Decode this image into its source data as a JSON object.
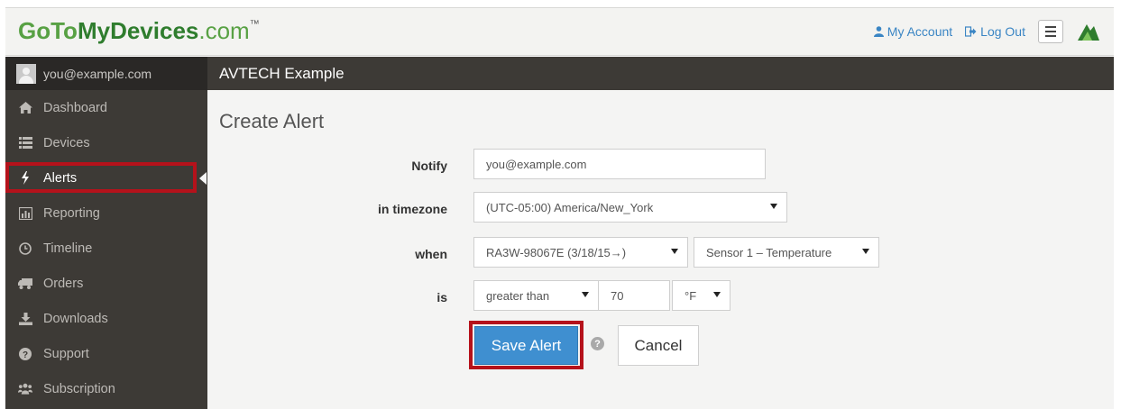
{
  "brand": {
    "part1": "GoTo",
    "part2": "MyDevices",
    "part3": ".com",
    "tm": "™"
  },
  "topnav": {
    "account": "My Account",
    "logout": "Log Out"
  },
  "sidebar": {
    "user_email": "you@example.com",
    "items": [
      {
        "label": "Dashboard",
        "icon": "home-icon"
      },
      {
        "label": "Devices",
        "icon": "list-icon"
      },
      {
        "label": "Alerts",
        "icon": "bolt-icon",
        "active": true
      },
      {
        "label": "Reporting",
        "icon": "bar-chart-icon"
      },
      {
        "label": "Timeline",
        "icon": "clock-icon"
      },
      {
        "label": "Orders",
        "icon": "truck-icon"
      },
      {
        "label": "Downloads",
        "icon": "download-icon"
      },
      {
        "label": "Support",
        "icon": "question-icon"
      },
      {
        "label": "Subscription",
        "icon": "users-icon"
      }
    ]
  },
  "main": {
    "header": "AVTECH Example",
    "title": "Create Alert",
    "form": {
      "notify_label": "Notify",
      "notify_value": "you@example.com",
      "timezone_label": "in timezone",
      "timezone_value": "(UTC-05:00) America/New_York",
      "when_label": "when",
      "device_value": "RA3W-98067E (3/18/15→)",
      "sensor_value": "Sensor 1 – Temperature",
      "is_label": "is",
      "comparator_value": "greater than",
      "threshold_value": "70",
      "unit_value": "°F"
    },
    "buttons": {
      "save": "Save Alert",
      "help": "?",
      "cancel": "Cancel"
    }
  },
  "colors": {
    "brand_green": "#58a144",
    "dark_green": "#2f7d2e",
    "sidebar_bg": "#3d3a36",
    "highlight_red": "#b5121b",
    "primary_blue": "#3f8fd0",
    "link_blue": "#3a85c4"
  }
}
